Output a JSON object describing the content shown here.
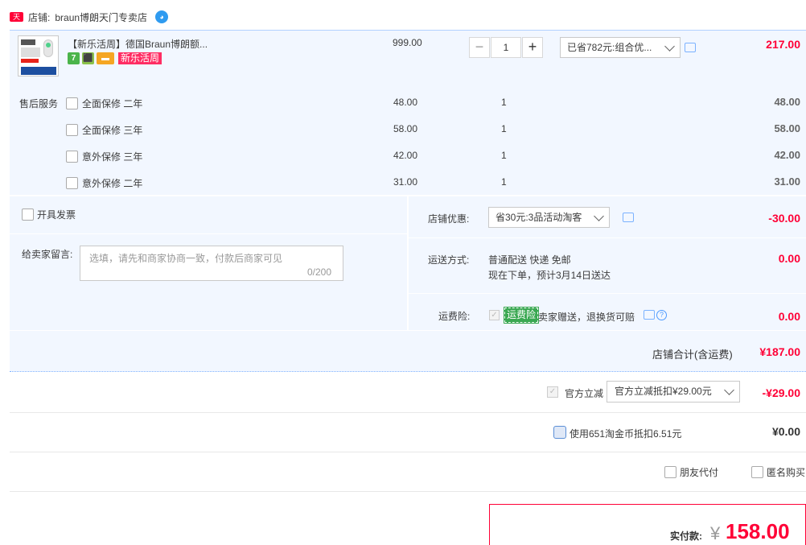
{
  "store": {
    "label": "店铺:",
    "name": "braun博朗天门专卖店",
    "badge": "天猫"
  },
  "item": {
    "title": "【新乐活周】德国Braun博朗额...",
    "price": "999.00",
    "quantity": "1",
    "promo_select": "已省782元:组合优...",
    "total": "217.00",
    "campaign_badge": "新乐活周"
  },
  "service": {
    "label": "售后服务",
    "rows": [
      {
        "name": "全面保修 二年",
        "price": "48.00",
        "qty": "1",
        "total": "48.00"
      },
      {
        "name": "全面保修 三年",
        "price": "58.00",
        "qty": "1",
        "total": "58.00"
      },
      {
        "name": "意外保修 三年",
        "price": "42.00",
        "qty": "1",
        "total": "42.00"
      },
      {
        "name": "意外保修 二年",
        "price": "31.00",
        "qty": "1",
        "total": "31.00"
      }
    ]
  },
  "invoice": {
    "label": "开具发票"
  },
  "message": {
    "label": "给卖家留言:",
    "placeholder": "选填，请先和商家协商一致，付款后商家可见",
    "counter": "0/200"
  },
  "shop_discount": {
    "label": "店铺优惠:",
    "select": "省30元:3品活动淘客",
    "amount": "-30.00"
  },
  "shipping": {
    "label": "运送方式:",
    "line1": "普通配送 快递 免邮",
    "line2": "现在下单，预计3月14日送达",
    "amount": "0.00"
  },
  "insurance": {
    "label": "运费险:",
    "tag": "运费险",
    "text": "卖家赠送，退换货可赔",
    "amount": "0.00"
  },
  "subtotal": {
    "label": "店铺合计(含运费)",
    "amount": "¥187.00"
  },
  "official": {
    "label": "官方立减",
    "select": "官方立减抵扣¥29.00元",
    "amount": "-¥29.00"
  },
  "coins": {
    "label": "使用651淘金币抵扣6.51元",
    "amount": "¥0.00"
  },
  "options": {
    "friend_pay": "朋友代付",
    "anonymous": "匿名购买"
  },
  "payment": {
    "label": "实付款:",
    "currency": "¥",
    "amount": "158.00"
  },
  "colors": {
    "accent_red": "#ff0036",
    "panel_bg": "#f2f7ff",
    "link_blue": "#4d9aff"
  }
}
